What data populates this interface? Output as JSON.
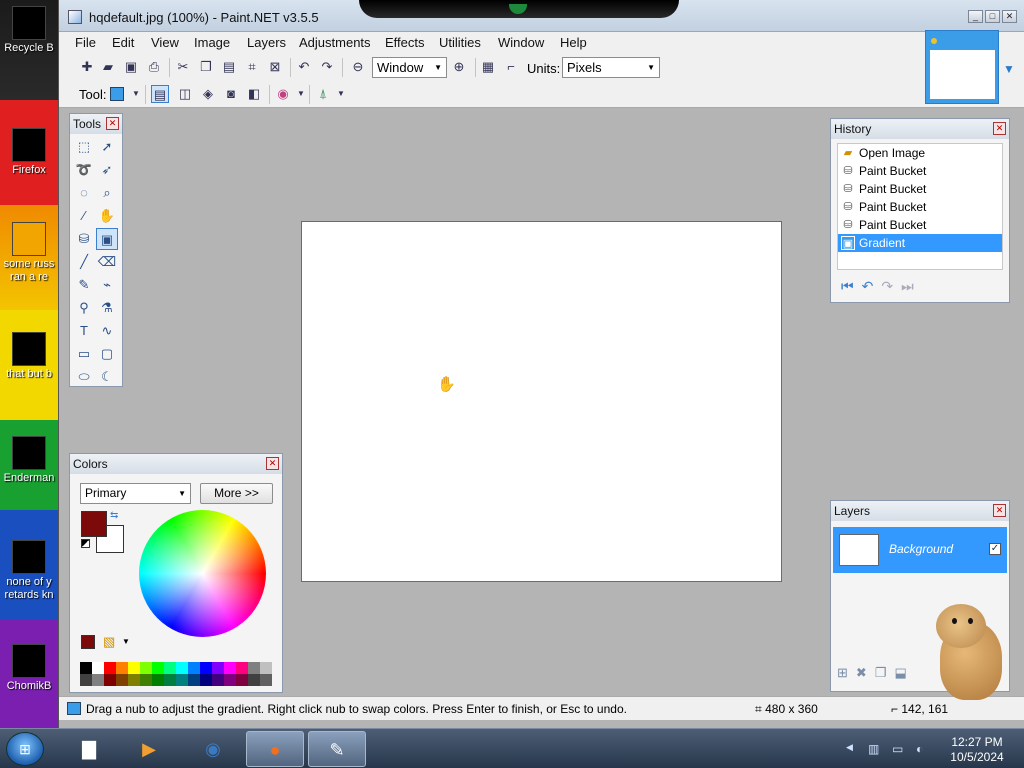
{
  "desktop": {
    "icons": [
      {
        "label": "Recycle B"
      },
      {
        "label": "Firefox"
      },
      {
        "label": "some russ"
      },
      {
        "label": "ran a re"
      },
      {
        "label": "that but b"
      },
      {
        "label": "Enderman"
      },
      {
        "label": "none of y"
      },
      {
        "label": "retards kn"
      },
      {
        "label": "ChomikB"
      }
    ]
  },
  "window": {
    "title": "hqdefault.jpg (100%) - Paint.NET v3.5.5"
  },
  "menu": {
    "items": [
      "File",
      "Edit",
      "View",
      "Image",
      "Layers",
      "Adjustments",
      "Effects",
      "Utilities",
      "Window",
      "Help"
    ]
  },
  "toolbar": {
    "zoom_value": "Window",
    "units_label": "Units:",
    "units_value": "Pixels",
    "tool_label": "Tool:"
  },
  "tools_panel": {
    "title": "Tools"
  },
  "colors_panel": {
    "title": "Colors",
    "mode": "Primary",
    "more_label": "More >>",
    "primary_color": "#7d0a0a",
    "secondary_color": "#ffffff",
    "palette_top": [
      "#000000",
      "#ffffff",
      "#ff0000",
      "#ff8000",
      "#ffff00",
      "#80ff00",
      "#00ff00",
      "#00ff80",
      "#00ffff",
      "#0080ff",
      "#0000ff",
      "#8000ff",
      "#ff00ff",
      "#ff0080",
      "#808080",
      "#c0c0c0"
    ],
    "palette_bottom": [
      "#404040",
      "#808080",
      "#800000",
      "#804000",
      "#808000",
      "#408000",
      "#008000",
      "#008040",
      "#008080",
      "#004080",
      "#000080",
      "#400080",
      "#800080",
      "#800040",
      "#404040",
      "#606060"
    ]
  },
  "history_panel": {
    "title": "History",
    "items": [
      {
        "label": "Open Image",
        "selected": false
      },
      {
        "label": "Paint Bucket",
        "selected": false
      },
      {
        "label": "Paint Bucket",
        "selected": false
      },
      {
        "label": "Paint Bucket",
        "selected": false
      },
      {
        "label": "Paint Bucket",
        "selected": false
      },
      {
        "label": "Gradient",
        "selected": true
      }
    ]
  },
  "layers_panel": {
    "title": "Layers",
    "layer_name": "Background"
  },
  "status": {
    "message": "Drag a nub to adjust the gradient. Right click nub to swap colors. Press Enter to finish, or Esc to undo.",
    "image_size": "480 x 360",
    "cursor_pos": "142, 161"
  },
  "taskbar": {
    "time": "12:27 PM",
    "date": "10/5/2024"
  }
}
